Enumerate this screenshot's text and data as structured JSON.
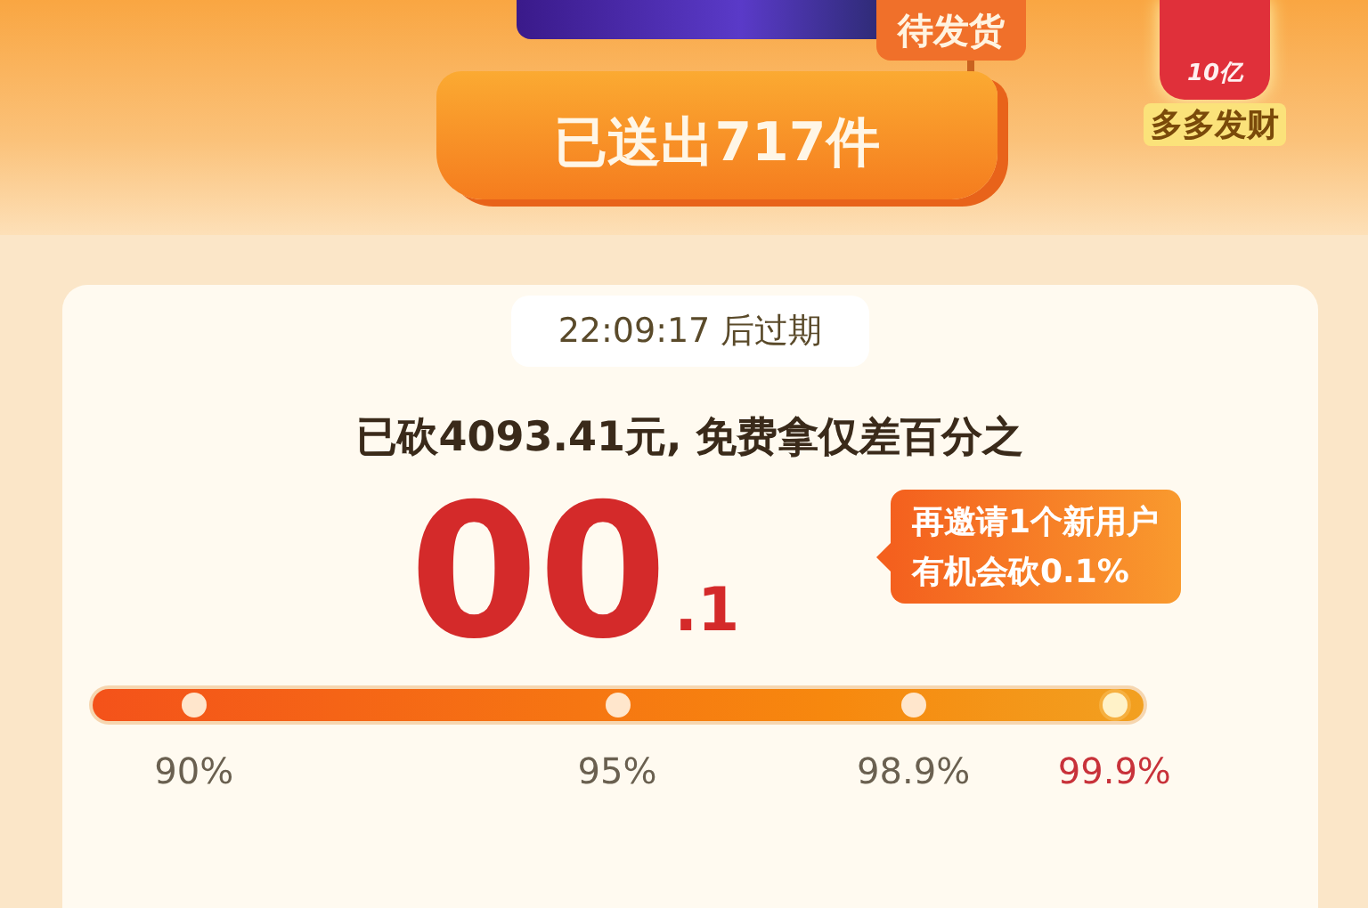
{
  "header": {
    "ship_tag": "待发货",
    "sent_banner": "已送出717件",
    "badge": {
      "amount": "10亿",
      "label": "多多发财"
    }
  },
  "card": {
    "timer": "22:09:17 后过期",
    "summary": "已砍**4093.41元**, 免费拿仅差百分之",
    "remaining_main": "00",
    "remaining_decimal": ".1",
    "tip_lines": [
      "再邀请1个新用户",
      "有机会砍0.1%"
    ],
    "progress": {
      "level": 1,
      "milestones": [
        {
          "label": "90%",
          "selected": false
        },
        {
          "label": "95%",
          "selected": false
        },
        {
          "label": "98.9%",
          "selected": false
        },
        {
          "label": "99.9%",
          "selected": true
        }
      ]
    }
  }
}
